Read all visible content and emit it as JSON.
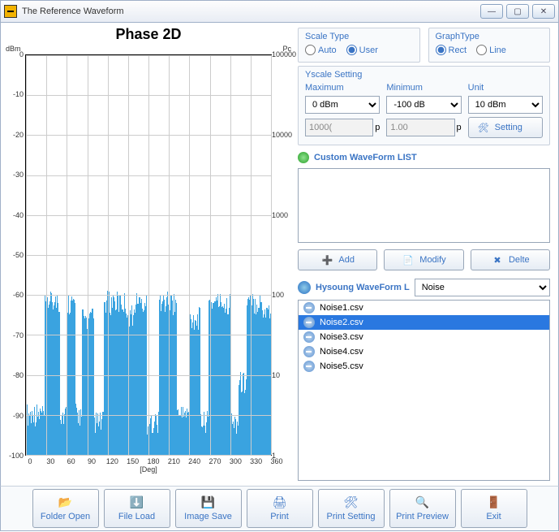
{
  "window": {
    "title": "The Reference Waveform"
  },
  "chart": {
    "title": "Phase 2D",
    "yleft_label": "dBm",
    "yright_label": "Pc",
    "xlabel": "[Deg]"
  },
  "chart_data": {
    "type": "bar",
    "title": "Phase 2D",
    "xlabel": "[Deg]",
    "ylabel": "dBm",
    "xlim": [
      0,
      360
    ],
    "ylim": [
      -100,
      0
    ],
    "y2label": "Pc",
    "y2lim": [
      1,
      100000
    ],
    "x_ticks": [
      0,
      30,
      60,
      90,
      120,
      150,
      180,
      210,
      240,
      270,
      300,
      330,
      360
    ],
    "y_ticks": [
      0,
      -10,
      -20,
      -30,
      -40,
      -50,
      -60,
      -70,
      -80,
      -90,
      -100
    ],
    "y2_ticks": [
      "100000",
      "10000",
      "1000",
      "100",
      "10",
      "1"
    ],
    "series": [
      {
        "name": "Noise2",
        "color": "#3aa3e0",
        "segments": [
          {
            "x0": 0,
            "x1": 28,
            "ymax": -90,
            "ymin": -100
          },
          {
            "x0": 28,
            "x1": 50,
            "ymax": -62,
            "ymin": -100
          },
          {
            "x0": 50,
            "x1": 60,
            "ymax": -90,
            "ymin": -100
          },
          {
            "x0": 60,
            "x1": 72,
            "ymax": -62,
            "ymin": -100
          },
          {
            "x0": 72,
            "x1": 82,
            "ymax": -90,
            "ymin": -100
          },
          {
            "x0": 82,
            "x1": 100,
            "ymax": -66,
            "ymin": -100
          },
          {
            "x0": 100,
            "x1": 115,
            "ymax": -92,
            "ymin": -100
          },
          {
            "x0": 115,
            "x1": 148,
            "ymax": -62,
            "ymin": -100
          },
          {
            "x0": 148,
            "x1": 160,
            "ymax": -65,
            "ymin": -100
          },
          {
            "x0": 160,
            "x1": 178,
            "ymax": -62,
            "ymin": -100
          },
          {
            "x0": 178,
            "x1": 195,
            "ymax": -92,
            "ymin": -100
          },
          {
            "x0": 195,
            "x1": 222,
            "ymax": -62,
            "ymin": -100
          },
          {
            "x0": 222,
            "x1": 240,
            "ymax": -90,
            "ymin": -100
          },
          {
            "x0": 240,
            "x1": 256,
            "ymax": -66,
            "ymin": -100
          },
          {
            "x0": 256,
            "x1": 268,
            "ymax": -92,
            "ymin": -100
          },
          {
            "x0": 268,
            "x1": 300,
            "ymax": -62,
            "ymin": -100
          },
          {
            "x0": 300,
            "x1": 312,
            "ymax": -92,
            "ymin": -100
          },
          {
            "x0": 312,
            "x1": 324,
            "ymax": -82,
            "ymin": -100
          },
          {
            "x0": 324,
            "x1": 348,
            "ymax": -62,
            "ymin": -100
          },
          {
            "x0": 348,
            "x1": 360,
            "ymax": -64,
            "ymin": -100
          }
        ]
      }
    ]
  },
  "scale": {
    "group_label": "Scale Type",
    "auto_label": "Auto",
    "user_label": "User",
    "selected": "user"
  },
  "graph": {
    "group_label": "GraphType",
    "rect_label": "Rect",
    "line_label": "Line",
    "selected": "rect"
  },
  "yscale": {
    "group_label": "Yscale Setting",
    "max_label": "Maximum",
    "min_label": "Minimum",
    "unit_label": "Unit",
    "max_value": "0 dBm",
    "min_value": "-100 dB",
    "unit_value": "10 dBm",
    "input1": "1000(",
    "input1_suffix": "p",
    "input2": "1.00",
    "input2_suffix": "p",
    "setting_btn": "Setting"
  },
  "custom": {
    "header": "Custom WaveForm LIST",
    "add_btn": "Add",
    "modify_btn": "Modify",
    "delete_btn": "Delte"
  },
  "hysoung": {
    "label": "Hysoung WaveForm L",
    "select_value": "Noise",
    "files": [
      "Noise1.csv",
      "Noise2.csv",
      "Noise3.csv",
      "Noise4.csv",
      "Noise5.csv"
    ],
    "selected_index": 1
  },
  "toolbar": {
    "folder_open": "Folder\nOpen",
    "file_load": "File Load",
    "image_save": "Image\nSave",
    "print": "Print",
    "print_setting": "Print\nSetting",
    "print_preview": "Print\nPreview",
    "exit": "Exit"
  }
}
